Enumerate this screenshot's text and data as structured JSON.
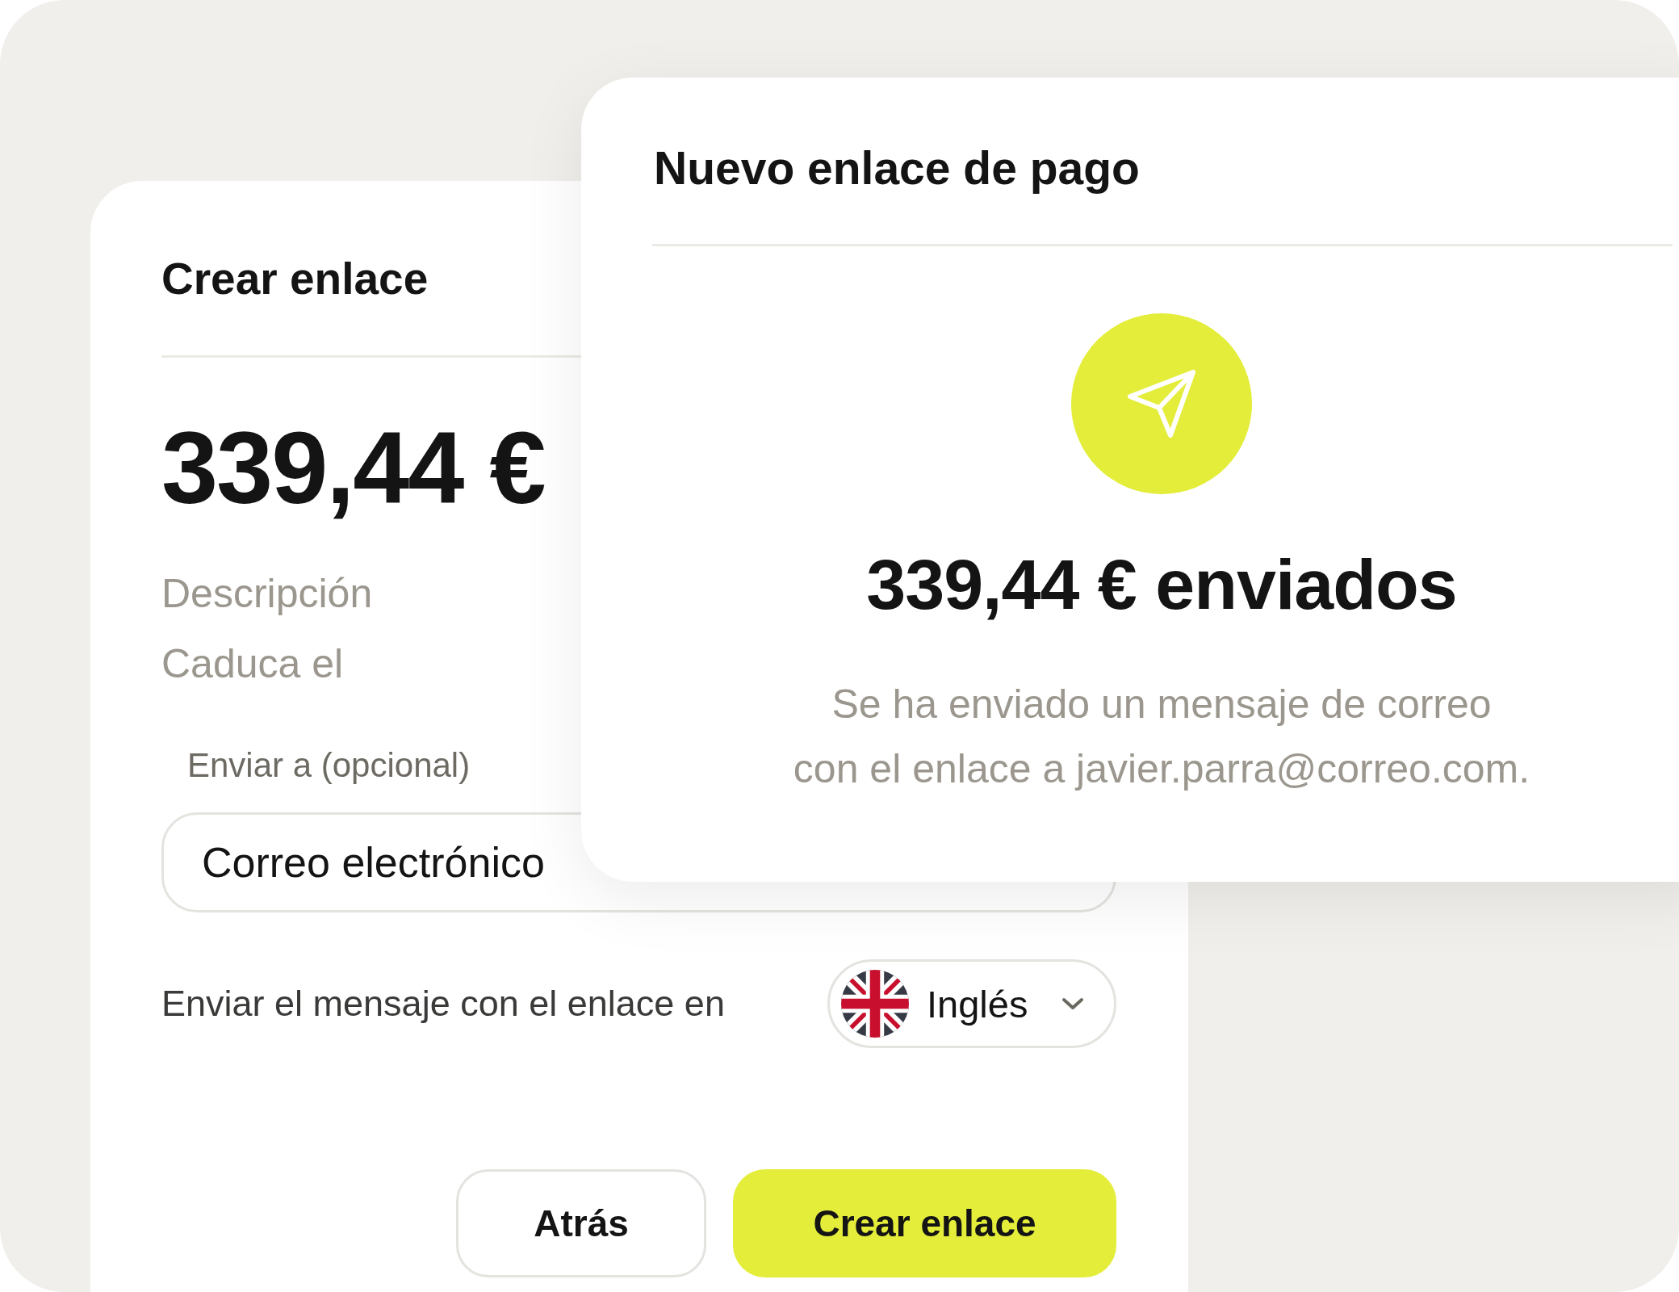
{
  "create_card": {
    "title": "Crear enlace",
    "amount": "339,44 €",
    "detail_labels": [
      "Descripción",
      "Caduca el"
    ],
    "recipient": {
      "label": "Enviar a (opcional)",
      "value": "Correo electrónico"
    },
    "language": {
      "label": "Enviar el mensaje con el enlace en",
      "value": "Inglés"
    },
    "buttons": [
      {
        "label": "Atrás",
        "kind": "secondary"
      },
      {
        "label": "Crear enlace",
        "kind": "primary"
      }
    ]
  },
  "sent_dialog": {
    "title": "Nuevo enlace de pago",
    "headline": "339,44 € enviados",
    "message_lines": [
      "Se ha enviado un mensaje de correo",
      "con el enlace a javier.parra@correo.com."
    ]
  }
}
